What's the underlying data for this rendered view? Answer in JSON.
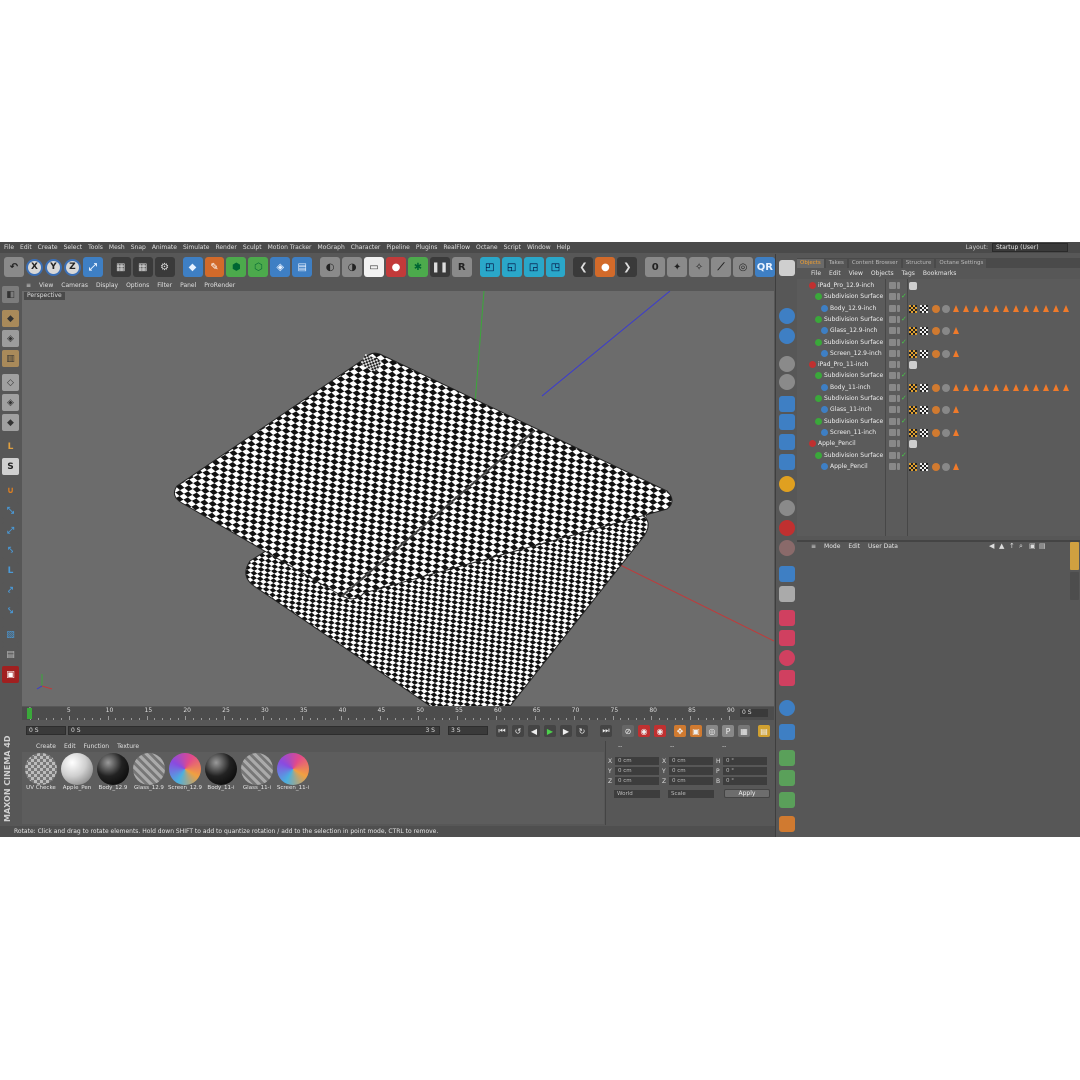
{
  "menubar": {
    "items": [
      "File",
      "Edit",
      "Create",
      "Select",
      "Tools",
      "Mesh",
      "Snap",
      "Animate",
      "Simulate",
      "Render",
      "Sculpt",
      "Motion Tracker",
      "MoGraph",
      "Character",
      "Pipeline",
      "Plugins",
      "RealFlow",
      "Octane",
      "Script",
      "Window",
      "Help"
    ],
    "layout_label": "Layout:",
    "layout_value": "Startup (User)"
  },
  "toolbar": {
    "axis_x": "X",
    "axis_y": "Y",
    "axis_z": "Z"
  },
  "viewport": {
    "menu": [
      "View",
      "Cameras",
      "Display",
      "Options",
      "Filter",
      "Panel",
      "ProRender"
    ],
    "label": "Perspective"
  },
  "timeline": {
    "ticks": [
      "0",
      "5",
      "10",
      "15",
      "20",
      "25",
      "30",
      "35",
      "40",
      "45",
      "50",
      "55",
      "60",
      "65",
      "70",
      "75",
      "80",
      "85",
      "90"
    ],
    "current_frame": "0 S",
    "start": "0 S",
    "preview_start": "0 S",
    "preview_end": "3 S",
    "end": "3 S"
  },
  "materials": {
    "menu": [
      "Create",
      "Edit",
      "Function",
      "Texture"
    ],
    "items": [
      {
        "name": "UV Checke",
        "style": "checker"
      },
      {
        "name": "Apple_Pen",
        "style": "white"
      },
      {
        "name": "Body_12.9",
        "style": "black"
      },
      {
        "name": "Glass_12.9",
        "style": "glass"
      },
      {
        "name": "Screen_12.9",
        "style": "screen"
      },
      {
        "name": "Body_11-i",
        "style": "black"
      },
      {
        "name": "Glass_11-i",
        "style": "glass"
      },
      {
        "name": "Screen_11-i",
        "style": "screen"
      }
    ],
    "brand": "MAXON CINEMA 4D"
  },
  "coords": {
    "headers": [
      "--",
      "--",
      "--"
    ],
    "rows": [
      {
        "a": "X",
        "av": "0 cm",
        "b": "X",
        "bv": "0 cm",
        "c": "H",
        "cv": "0 °"
      },
      {
        "a": "Y",
        "av": "0 cm",
        "b": "Y",
        "bv": "0 cm",
        "c": "P",
        "cv": "0 °"
      },
      {
        "a": "Z",
        "av": "0 cm",
        "b": "Z",
        "bv": "0 cm",
        "c": "B",
        "cv": "0 °"
      }
    ],
    "mode1": "World",
    "mode2": "Scale",
    "apply": "Apply"
  },
  "status": "Rotate: Click and drag to rotate elements. Hold down SHIFT to add to quantize rotation / add to the selection in point mode, CTRL to remove.",
  "object_manager": {
    "tabs": [
      "Objects",
      "Takes",
      "Content Browser",
      "Structure",
      "Octane Settings"
    ],
    "menu": [
      "File",
      "Edit",
      "View",
      "Objects",
      "Tags",
      "Bookmarks"
    ],
    "rows": [
      {
        "name": "iPad_Pro_12.9-inch",
        "level": 0,
        "type": "null",
        "tris": 0
      },
      {
        "name": "Subdivision Surface",
        "level": 1,
        "type": "subd",
        "tris": 0
      },
      {
        "name": "Body_12.9-inch",
        "level": 2,
        "type": "poly",
        "tris": 12
      },
      {
        "name": "Subdivision Surface",
        "level": 1,
        "type": "subd",
        "tris": 0
      },
      {
        "name": "Glass_12.9-inch",
        "level": 2,
        "type": "poly",
        "tris": 1
      },
      {
        "name": "Subdivision Surface",
        "level": 1,
        "type": "subd",
        "tris": 0
      },
      {
        "name": "Screen_12.9-inch",
        "level": 2,
        "type": "poly",
        "tris": 1
      },
      {
        "name": "iPad_Pro_11-inch",
        "level": 0,
        "type": "null",
        "tris": 0
      },
      {
        "name": "Subdivision Surface",
        "level": 1,
        "type": "subd",
        "tris": 0
      },
      {
        "name": "Body_11-inch",
        "level": 2,
        "type": "poly",
        "tris": 12
      },
      {
        "name": "Subdivision Surface",
        "level": 1,
        "type": "subd",
        "tris": 0
      },
      {
        "name": "Glass_11-inch",
        "level": 2,
        "type": "poly",
        "tris": 1
      },
      {
        "name": "Subdivision Surface",
        "level": 1,
        "type": "subd",
        "tris": 0
      },
      {
        "name": "Screen_11-inch",
        "level": 2,
        "type": "poly",
        "tris": 1
      },
      {
        "name": "Apple_Pencil",
        "level": 0,
        "type": "null",
        "tris": 0
      },
      {
        "name": "Subdivision Surface",
        "level": 1,
        "type": "subd",
        "tris": 0
      },
      {
        "name": "Apple_Pencil",
        "level": 2,
        "type": "poly",
        "tris": 1
      }
    ]
  },
  "attribute_manager": {
    "menu": [
      "Mode",
      "Edit",
      "User Data"
    ]
  },
  "colors": {
    "accent_orange": "#f07a2a",
    "active_tab": "#f3a030",
    "axis_blue": "#3b6fb5",
    "check_green": "#46c846"
  }
}
